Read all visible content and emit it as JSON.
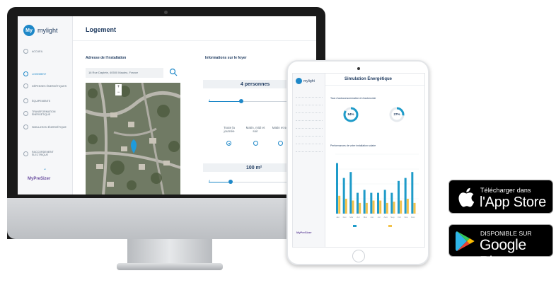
{
  "imac": {
    "app_logo_text": "mylight",
    "logo_badge": "My",
    "page_title": "Logement",
    "sidebar": {
      "items": [
        {
          "label": "ACCUEIL",
          "icon": "home-icon",
          "active": false
        },
        {
          "label": "LOGEMENT",
          "icon": "house-check-icon",
          "active": true
        },
        {
          "label": "DÉPENSES ÉNERGÉTIQUES",
          "icon": "euro-icon",
          "active": false
        },
        {
          "label": "ÉQUIPEMENTS",
          "icon": "plug-icon",
          "active": false
        },
        {
          "label": "TRANSFORMATION ÉNERGÉTIQUE",
          "icon": "refresh-icon",
          "active": false
        },
        {
          "label": "SIMULATION ÉNERGÉTIQUE",
          "icon": "chart-icon",
          "active": false
        },
        {
          "label": "RACCORDEMENT ÉLECTRIQUE",
          "icon": "bolt-icon",
          "active": false
        }
      ],
      "footer_brand": "MyPreSizer"
    },
    "address_section": {
      "title": "Adresse de l'installation",
      "address_value": "16 Rue Daplete, 40500 Mauleu, France"
    },
    "household_section": {
      "title": "Informations sur le foyer",
      "persons_value": "4 personnes",
      "options": [
        "Toute la journée",
        "Matin, midi et soir",
        "Matin et soir"
      ],
      "surface_value": "100 m²"
    }
  },
  "ipad": {
    "app_logo_text": "mylight",
    "page_title": "Simulation Énergétique",
    "section1_title": "Taux d'autoconsommation et d'autonomie",
    "gauge1_value": "84%",
    "gauge2_value": "27%",
    "section2_title": "Performances de votre installation solaire",
    "footer_brand": "MyPreSizer",
    "colors": {
      "production": "#1e9bc9",
      "consumption": "#f2c24a"
    }
  },
  "chart_data": {
    "type": "bar",
    "categories": [
      "Jan",
      "Fév",
      "Mar",
      "Avr",
      "Mai",
      "Jun",
      "Jul",
      "Aoû",
      "Sep",
      "Oct",
      "Nov",
      "Déc"
    ],
    "series": [
      {
        "values": [
          85,
          60,
          70,
          35,
          40,
          35,
          35,
          40,
          35,
          55,
          60,
          70
        ]
      },
      {
        "values": [
          30,
          25,
          22,
          18,
          18,
          22,
          22,
          18,
          20,
          22,
          25,
          18
        ]
      }
    ]
  },
  "badges": {
    "app_store": {
      "line1": "Télécharger dans",
      "line2": "l'App Store",
      "icon": "apple-icon"
    },
    "google_play": {
      "line1": "DISPONIBLE SUR",
      "line2": "Google Play",
      "icon": "play-icon"
    }
  }
}
